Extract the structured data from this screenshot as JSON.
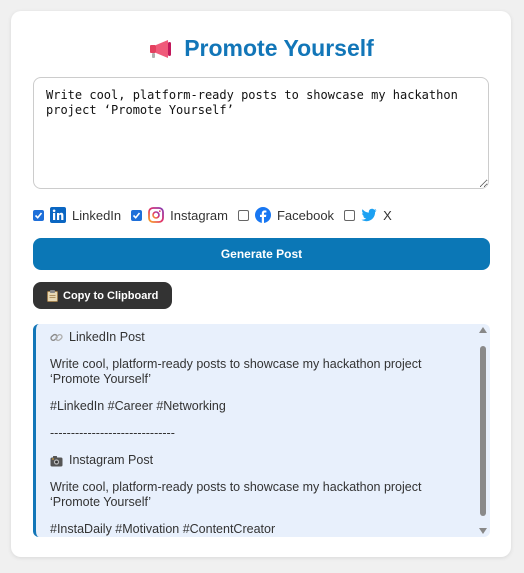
{
  "header": {
    "title": "Promote Yourself",
    "icon": "megaphone-icon"
  },
  "prompt": {
    "value": "Write cool, platform-ready posts to showcase my hackathon project ‘Promote Yourself’"
  },
  "platforms": [
    {
      "label": "LinkedIn",
      "checked": true,
      "icon": "linkedin-icon",
      "color": "#0a66c2"
    },
    {
      "label": "Instagram",
      "checked": true,
      "icon": "instagram-icon",
      "color": "#e1306c"
    },
    {
      "label": "Facebook",
      "checked": false,
      "icon": "facebook-icon",
      "color": "#1877f2"
    },
    {
      "label": "X",
      "checked": false,
      "icon": "twitter-bird-icon",
      "color": "#1da1f2"
    }
  ],
  "buttons": {
    "generate": "Generate Post",
    "copy": "Copy to Clipboard"
  },
  "output": {
    "linkedin": {
      "heading": "LinkedIn Post",
      "body": "Write cool, platform-ready posts to showcase my hackathon project ‘Promote Yourself’",
      "tags": "#LinkedIn #Career #Networking"
    },
    "divider": "------------------------------",
    "instagram": {
      "heading": "Instagram Post",
      "body": "Write cool, platform-ready posts to showcase my hackathon project ‘Promote Yourself’",
      "tags": "#InstaDaily #Motivation #ContentCreator"
    }
  },
  "colors": {
    "accent": "#1276b8",
    "button": "#0b77b6",
    "copy_button": "#333333",
    "output_bg": "#e8f0fc"
  }
}
